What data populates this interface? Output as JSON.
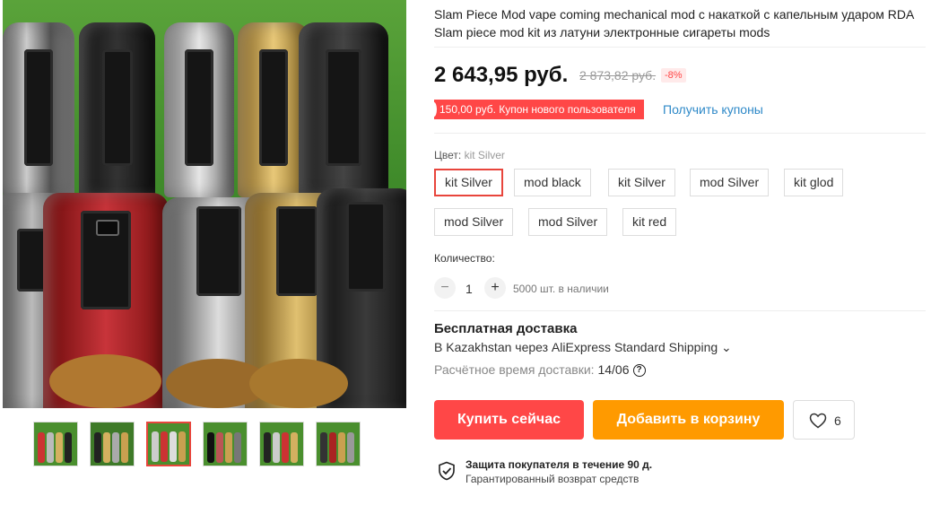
{
  "product": {
    "title": "Slam Piece Mod vape coming mechanical mod с накаткой с капельным ударом RDA Slam piece mod kit из латуни электронные сигареты mods"
  },
  "price": {
    "current": "2 643,95 руб.",
    "original": "2 873,82 руб.",
    "discount": "-8%"
  },
  "coupon": {
    "badge": "150,00 руб. Купон нового пользователя",
    "link": "Получить купоны"
  },
  "color": {
    "label": "Цвет:",
    "selected": "kit Silver",
    "options": [
      "kit Silver",
      "mod black",
      "kit Silver",
      "mod Silver",
      "kit glod",
      "mod Silver",
      "mod Silver",
      "kit red"
    ]
  },
  "quantity": {
    "label": "Количество:",
    "minus": "−",
    "value": "1",
    "plus": "+",
    "stock": "5000 шт. в наличии"
  },
  "shipping": {
    "title": "Бесплатная доставка",
    "line": "В Kazakhstan через AliExpress Standard Shipping ⌄",
    "time_label": "Расчётное время доставки:",
    "time_value": "14/06",
    "help": "?"
  },
  "actions": {
    "buy": "Купить сейчас",
    "cart": "Добавить в корзину",
    "wish_count": "6"
  },
  "protection": {
    "title": "Защита покупателя в течение 90 д.",
    "subtitle": "Гарантированный возврат средств"
  },
  "colors": {
    "accent": "#ff4747",
    "cart": "#ff9a00",
    "link": "#2e89c8"
  }
}
